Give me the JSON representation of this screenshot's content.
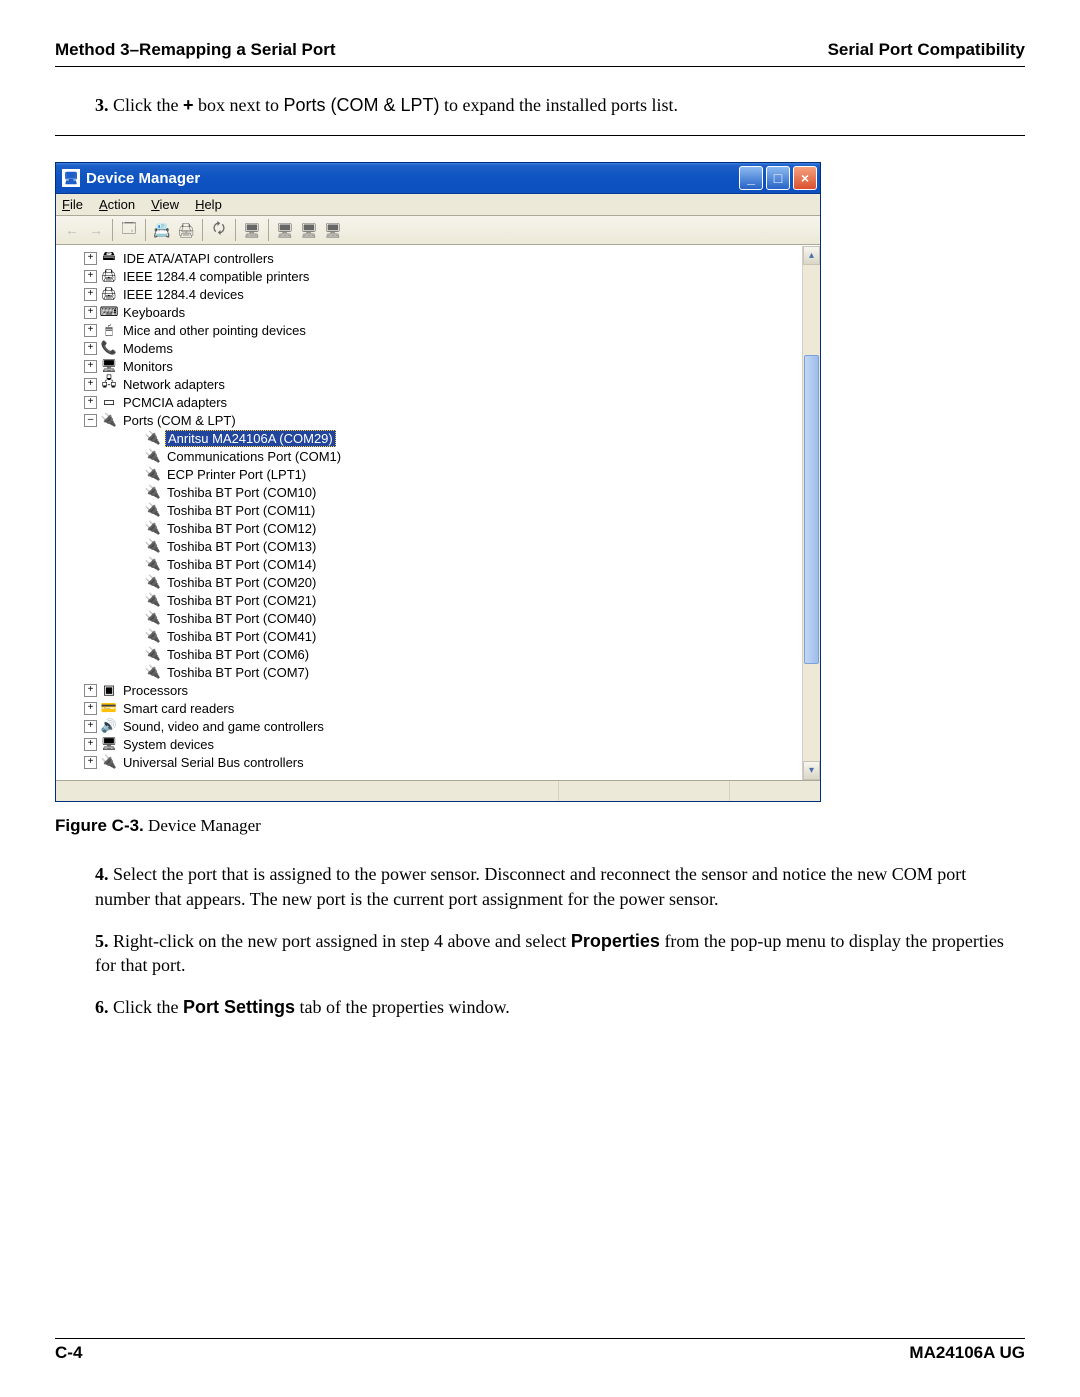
{
  "header": {
    "left": "Method 3–Remapping a Serial Port",
    "right": "Serial Port Compatibility"
  },
  "step3": {
    "num": "3.",
    "a": "Click the ",
    "plus": "+",
    "b": " box next to ",
    "ports": "Ports (COM & LPT)",
    "c": " to expand the installed ports list."
  },
  "dm": {
    "title": "Device Manager",
    "menu": {
      "file": "File",
      "action": "Action",
      "view": "View",
      "help": "Help"
    },
    "tree": {
      "top": [
        {
          "label": "IDE ATA/ATAPI controllers",
          "icon": "🖴"
        },
        {
          "label": "IEEE 1284.4 compatible printers",
          "icon": "🖨"
        },
        {
          "label": "IEEE 1284.4 devices",
          "icon": "🖨"
        },
        {
          "label": "Keyboards",
          "icon": "⌨"
        },
        {
          "label": "Mice and other pointing devices",
          "icon": "🖱"
        },
        {
          "label": "Modems",
          "icon": "📞"
        },
        {
          "label": "Monitors",
          "icon": "🖥"
        },
        {
          "label": "Network adapters",
          "icon": "🖧"
        },
        {
          "label": "PCMCIA adapters",
          "icon": "▭"
        }
      ],
      "ports_label": "Ports (COM & LPT)",
      "ports": [
        "Anritsu MA24106A (COM29)",
        "Communications Port (COM1)",
        "ECP Printer Port (LPT1)",
        "Toshiba BT Port (COM10)",
        "Toshiba BT Port (COM11)",
        "Toshiba BT Port (COM12)",
        "Toshiba BT Port (COM13)",
        "Toshiba BT Port (COM14)",
        "Toshiba BT Port (COM20)",
        "Toshiba BT Port (COM21)",
        "Toshiba BT Port (COM40)",
        "Toshiba BT Port (COM41)",
        "Toshiba BT Port (COM6)",
        "Toshiba BT Port (COM7)"
      ],
      "bottom": [
        {
          "label": "Processors",
          "icon": "▣"
        },
        {
          "label": "Smart card readers",
          "icon": "💳"
        },
        {
          "label": "Sound, video and game controllers",
          "icon": "🔊"
        },
        {
          "label": "System devices",
          "icon": "🖥"
        },
        {
          "label": "Universal Serial Bus controllers",
          "icon": "🔌"
        }
      ]
    }
  },
  "figcap": {
    "bold": "Figure C-3.",
    "rest": "   Device Manager"
  },
  "step4": {
    "num": "4.",
    "text": "Select the port that is assigned to the power sensor. Disconnect and reconnect the sensor and notice the new COM port number that appears. The new port is the current port assignment for the power sensor."
  },
  "step5": {
    "num": "5.",
    "a": "Right-click on the new port assigned in step 4 above and select ",
    "props": "Properties",
    "b": " from the pop-up menu to display the properties for that port."
  },
  "step6": {
    "num": "6.",
    "a": "Click the ",
    "ps": "Port Settings",
    "b": " tab of the properties window."
  },
  "footer": {
    "left": "C-4",
    "right": "MA24106A UG"
  }
}
